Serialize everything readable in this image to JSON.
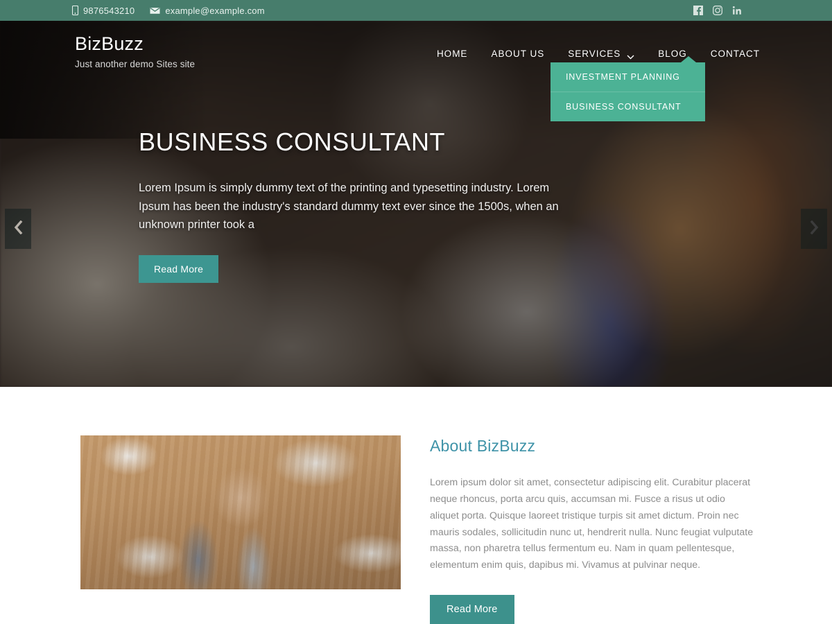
{
  "topbar": {
    "phone": "9876543210",
    "email": "example@example.com",
    "phone_icon": "mobile-phone-icon",
    "email_icon": "envelope-icon",
    "social": [
      {
        "name": "facebook-icon",
        "label": "Facebook"
      },
      {
        "name": "instagram-icon",
        "label": "Instagram"
      },
      {
        "name": "linkedin-icon",
        "label": "LinkedIn"
      }
    ],
    "bg_color": "#477d6c"
  },
  "header": {
    "brand": "BizBuzz",
    "tagline": "Just another demo Sites site",
    "nav": [
      {
        "label": "HOME"
      },
      {
        "label": "ABOUT US"
      },
      {
        "label": "SERVICES",
        "has_dropdown": true,
        "icon": "chevron-down-icon"
      },
      {
        "label": "BLOG"
      },
      {
        "label": "CONTACT"
      }
    ],
    "dropdown": {
      "accent_color": "#4cb295",
      "items": [
        {
          "label": "INVESTMENT PLANNING"
        },
        {
          "label": "BUSINESS CONSULTANT"
        }
      ]
    }
  },
  "hero": {
    "title": "BUSINESS CONSULTANT",
    "text": "Lorem Ipsum is simply dummy text of the printing and typesetting industry. Lorem Ipsum has been the industry's standard dummy text ever since the 1500s, when an unknown printer took a",
    "button_label": "Read More",
    "button_color": "#3d9691",
    "prev_icon": "chevron-left-icon",
    "next_icon": "chevron-right-icon"
  },
  "about": {
    "title": "About BizBuzz",
    "title_color": "#3f93a8",
    "text": "Lorem ipsum dolor sit amet, consectetur adipiscing elit. Curabitur placerat neque rhoncus, porta arcu quis, accumsan mi. Fusce a risus ut odio aliquet porta. Quisque laoreet tristique turpis sit amet dictum. Proin nec mauris sodales, sollicitudin nunc ut, hendrerit nulla. Nunc feugiat vulputate massa, non pharetra tellus fermentum eu. Nam in quam pellentesque, elementum enim quis, dapibus mi. Vivamus at pulvinar neque.",
    "button_label": "Read More",
    "button_color": "#3d918c",
    "image_name": "team-fistbump-desk-photo"
  }
}
